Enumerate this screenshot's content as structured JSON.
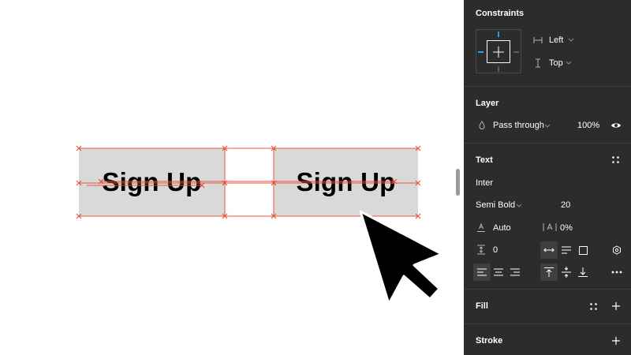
{
  "canvas": {
    "button_left": {
      "label": "Sign Up"
    },
    "button_right": {
      "label": "Sign Up"
    },
    "guide_color": "#e8553e",
    "box_color": "#d9d9d9"
  },
  "panel": {
    "constraints": {
      "title": "Constraints",
      "horizontal": "Left",
      "vertical": "Top"
    },
    "layer": {
      "title": "Layer",
      "blend_mode": "Pass through",
      "opacity": "100%"
    },
    "text": {
      "title": "Text",
      "font_family": "Inter",
      "font_weight": "Semi Bold",
      "font_size": "20",
      "line_height": "Auto",
      "letter_spacing": "0%",
      "paragraph_spacing": "0"
    },
    "fill": {
      "title": "Fill"
    },
    "stroke": {
      "title": "Stroke"
    },
    "icons": [
      "horizontal-constraint-icon",
      "vertical-constraint-icon",
      "blend-drop-icon",
      "eye-icon",
      "styles-grid-icon",
      "line-height-icon",
      "letter-spacing-icon",
      "paragraph-spacing-icon",
      "auto-width-icon",
      "auto-height-icon",
      "fixed-size-icon",
      "text-settings-icon",
      "align-left-icon",
      "align-center-icon",
      "align-right-icon",
      "align-top-icon",
      "align-middle-icon",
      "align-bottom-icon",
      "more-icon",
      "plus-icon"
    ],
    "colors": {
      "background": "#2c2c2c",
      "accent": "#18a0fb",
      "divider": "#3d3d3d"
    }
  }
}
